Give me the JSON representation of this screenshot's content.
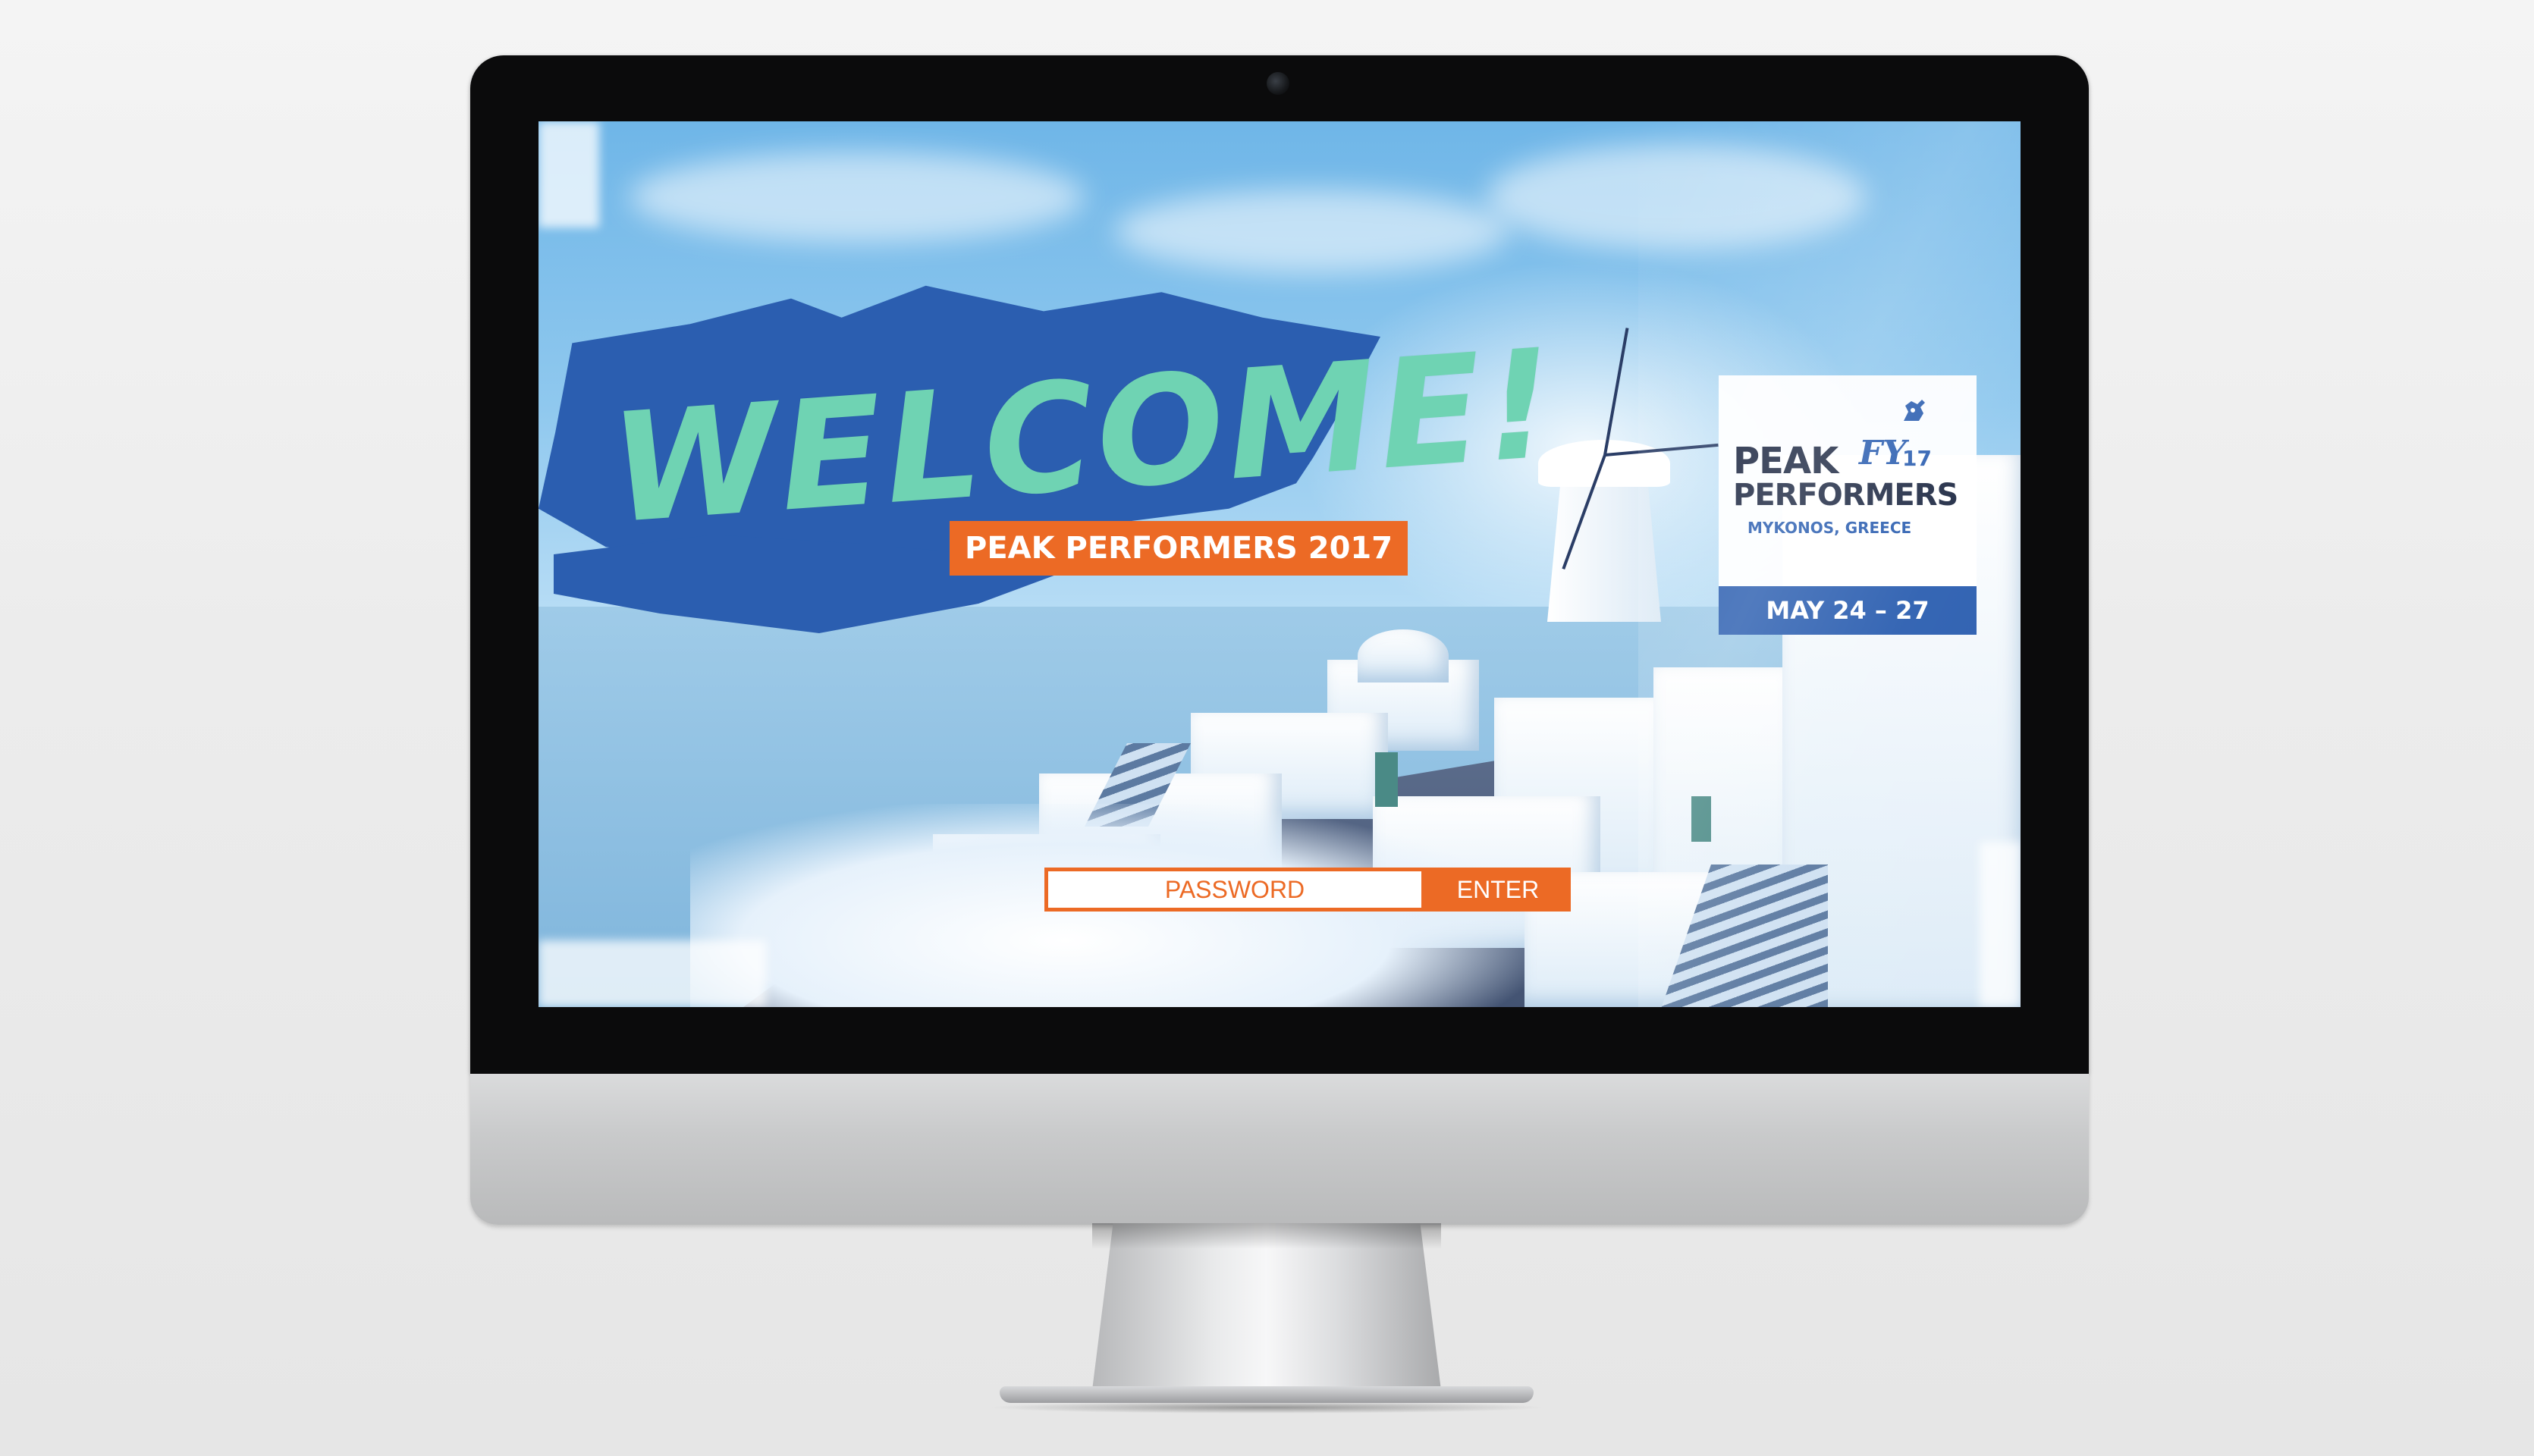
{
  "hero": {
    "headline": "WELCOME!",
    "tagline": "PEAK PERFORMERS 2017"
  },
  "logo": {
    "peak": "PEAK",
    "fy": "FY",
    "year": "17",
    "performers": "PERFORMERS",
    "location": "MYKONOS, GREECE",
    "dates": "MAY 24 – 27",
    "icon": "pegasus-icon"
  },
  "login": {
    "password_placeholder": "PASSWORD",
    "enter_label": "ENTER"
  },
  "colors": {
    "brand_blue": "#2b5eb0",
    "accent_orange": "#ec6a25",
    "headline_mint": "#6fd3b3",
    "logo_navy": "#1f2a44"
  }
}
